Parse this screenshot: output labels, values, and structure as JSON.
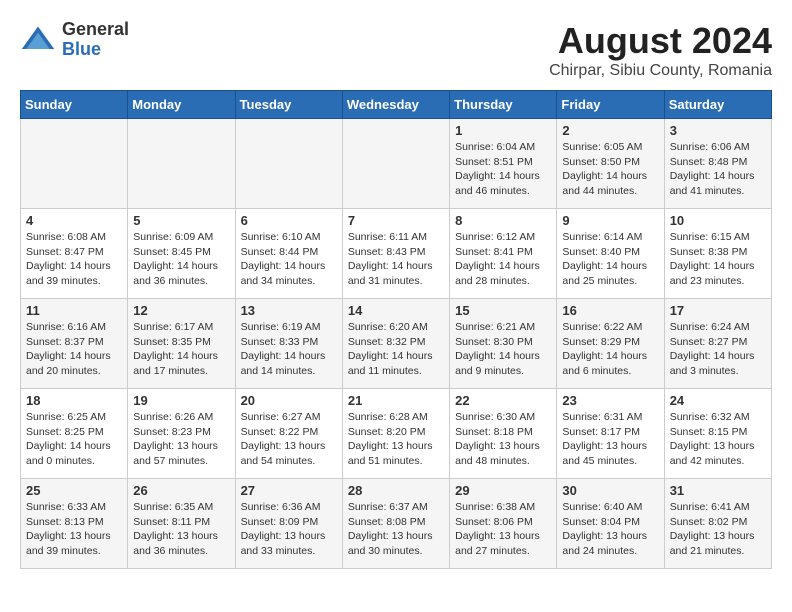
{
  "logo": {
    "general": "General",
    "blue": "Blue"
  },
  "title": {
    "month_year": "August 2024",
    "location": "Chirpar, Sibiu County, Romania"
  },
  "weekdays": [
    "Sunday",
    "Monday",
    "Tuesday",
    "Wednesday",
    "Thursday",
    "Friday",
    "Saturday"
  ],
  "weeks": [
    [
      {
        "day": "",
        "info": ""
      },
      {
        "day": "",
        "info": ""
      },
      {
        "day": "",
        "info": ""
      },
      {
        "day": "",
        "info": ""
      },
      {
        "day": "1",
        "info": "Sunrise: 6:04 AM\nSunset: 8:51 PM\nDaylight: 14 hours and 46 minutes."
      },
      {
        "day": "2",
        "info": "Sunrise: 6:05 AM\nSunset: 8:50 PM\nDaylight: 14 hours and 44 minutes."
      },
      {
        "day": "3",
        "info": "Sunrise: 6:06 AM\nSunset: 8:48 PM\nDaylight: 14 hours and 41 minutes."
      }
    ],
    [
      {
        "day": "4",
        "info": "Sunrise: 6:08 AM\nSunset: 8:47 PM\nDaylight: 14 hours and 39 minutes."
      },
      {
        "day": "5",
        "info": "Sunrise: 6:09 AM\nSunset: 8:45 PM\nDaylight: 14 hours and 36 minutes."
      },
      {
        "day": "6",
        "info": "Sunrise: 6:10 AM\nSunset: 8:44 PM\nDaylight: 14 hours and 34 minutes."
      },
      {
        "day": "7",
        "info": "Sunrise: 6:11 AM\nSunset: 8:43 PM\nDaylight: 14 hours and 31 minutes."
      },
      {
        "day": "8",
        "info": "Sunrise: 6:12 AM\nSunset: 8:41 PM\nDaylight: 14 hours and 28 minutes."
      },
      {
        "day": "9",
        "info": "Sunrise: 6:14 AM\nSunset: 8:40 PM\nDaylight: 14 hours and 25 minutes."
      },
      {
        "day": "10",
        "info": "Sunrise: 6:15 AM\nSunset: 8:38 PM\nDaylight: 14 hours and 23 minutes."
      }
    ],
    [
      {
        "day": "11",
        "info": "Sunrise: 6:16 AM\nSunset: 8:37 PM\nDaylight: 14 hours and 20 minutes."
      },
      {
        "day": "12",
        "info": "Sunrise: 6:17 AM\nSunset: 8:35 PM\nDaylight: 14 hours and 17 minutes."
      },
      {
        "day": "13",
        "info": "Sunrise: 6:19 AM\nSunset: 8:33 PM\nDaylight: 14 hours and 14 minutes."
      },
      {
        "day": "14",
        "info": "Sunrise: 6:20 AM\nSunset: 8:32 PM\nDaylight: 14 hours and 11 minutes."
      },
      {
        "day": "15",
        "info": "Sunrise: 6:21 AM\nSunset: 8:30 PM\nDaylight: 14 hours and 9 minutes."
      },
      {
        "day": "16",
        "info": "Sunrise: 6:22 AM\nSunset: 8:29 PM\nDaylight: 14 hours and 6 minutes."
      },
      {
        "day": "17",
        "info": "Sunrise: 6:24 AM\nSunset: 8:27 PM\nDaylight: 14 hours and 3 minutes."
      }
    ],
    [
      {
        "day": "18",
        "info": "Sunrise: 6:25 AM\nSunset: 8:25 PM\nDaylight: 14 hours and 0 minutes."
      },
      {
        "day": "19",
        "info": "Sunrise: 6:26 AM\nSunset: 8:23 PM\nDaylight: 13 hours and 57 minutes."
      },
      {
        "day": "20",
        "info": "Sunrise: 6:27 AM\nSunset: 8:22 PM\nDaylight: 13 hours and 54 minutes."
      },
      {
        "day": "21",
        "info": "Sunrise: 6:28 AM\nSunset: 8:20 PM\nDaylight: 13 hours and 51 minutes."
      },
      {
        "day": "22",
        "info": "Sunrise: 6:30 AM\nSunset: 8:18 PM\nDaylight: 13 hours and 48 minutes."
      },
      {
        "day": "23",
        "info": "Sunrise: 6:31 AM\nSunset: 8:17 PM\nDaylight: 13 hours and 45 minutes."
      },
      {
        "day": "24",
        "info": "Sunrise: 6:32 AM\nSunset: 8:15 PM\nDaylight: 13 hours and 42 minutes."
      }
    ],
    [
      {
        "day": "25",
        "info": "Sunrise: 6:33 AM\nSunset: 8:13 PM\nDaylight: 13 hours and 39 minutes."
      },
      {
        "day": "26",
        "info": "Sunrise: 6:35 AM\nSunset: 8:11 PM\nDaylight: 13 hours and 36 minutes."
      },
      {
        "day": "27",
        "info": "Sunrise: 6:36 AM\nSunset: 8:09 PM\nDaylight: 13 hours and 33 minutes."
      },
      {
        "day": "28",
        "info": "Sunrise: 6:37 AM\nSunset: 8:08 PM\nDaylight: 13 hours and 30 minutes."
      },
      {
        "day": "29",
        "info": "Sunrise: 6:38 AM\nSunset: 8:06 PM\nDaylight: 13 hours and 27 minutes."
      },
      {
        "day": "30",
        "info": "Sunrise: 6:40 AM\nSunset: 8:04 PM\nDaylight: 13 hours and 24 minutes."
      },
      {
        "day": "31",
        "info": "Sunrise: 6:41 AM\nSunset: 8:02 PM\nDaylight: 13 hours and 21 minutes."
      }
    ]
  ]
}
